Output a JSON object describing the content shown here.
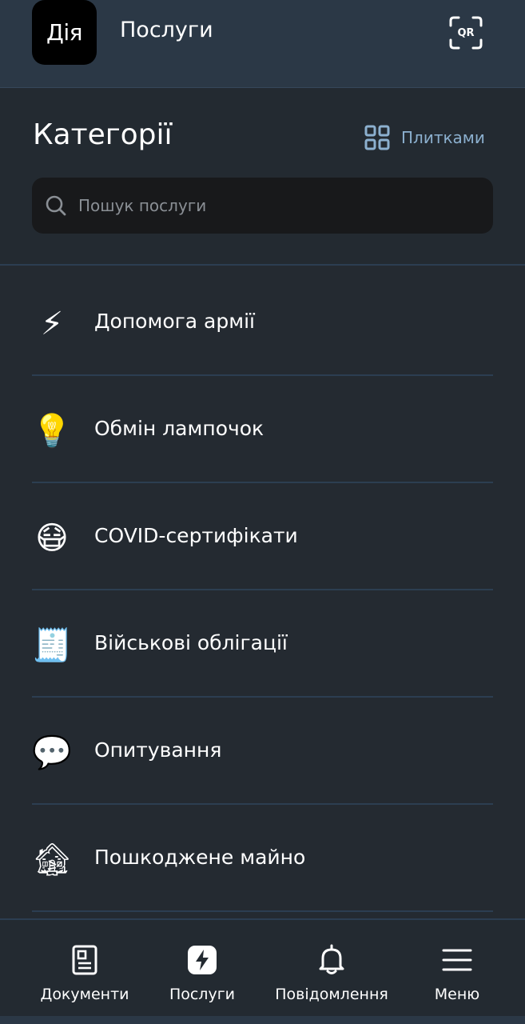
{
  "header": {
    "logo_text": "Дія",
    "title": "Послуги",
    "qr_label": "QR"
  },
  "categories": {
    "title": "Категорії",
    "view_toggle_label": "Плитками",
    "search_placeholder": "Пошук послуги"
  },
  "list": [
    {
      "emoji": "⚡",
      "label": "Допомога армії",
      "icon": "lightning-icon"
    },
    {
      "emoji": "💡",
      "label": "Обмін лампочок",
      "icon": "light-bulb-icon"
    },
    {
      "emoji": "😷",
      "label": "COVID-сертифікати",
      "icon": "face-with-mask-icon"
    },
    {
      "emoji": "🧾",
      "label": "Військові облігації",
      "icon": "receipt-scroll-icon"
    },
    {
      "emoji": "💬",
      "label": "Опитування",
      "icon": "speech-bubble-icon"
    },
    {
      "emoji": "🏚",
      "label": "Пошкоджене майно",
      "icon": "derelict-house-icon"
    }
  ],
  "bottom_nav": [
    {
      "label": "Документи",
      "icon": "document-icon",
      "active": false
    },
    {
      "label": "Послуги",
      "icon": "lightning-icon",
      "active": true
    },
    {
      "label": "Повідомлення",
      "icon": "bell-icon",
      "active": false
    },
    {
      "label": "Меню",
      "icon": "hamburger-menu-icon",
      "active": false
    }
  ],
  "colors": {
    "background": "#242a31",
    "header_background": "#2b3846",
    "search_background": "#18191b",
    "divider": "#2c3e51",
    "accent_link": "#8cb0cf"
  }
}
